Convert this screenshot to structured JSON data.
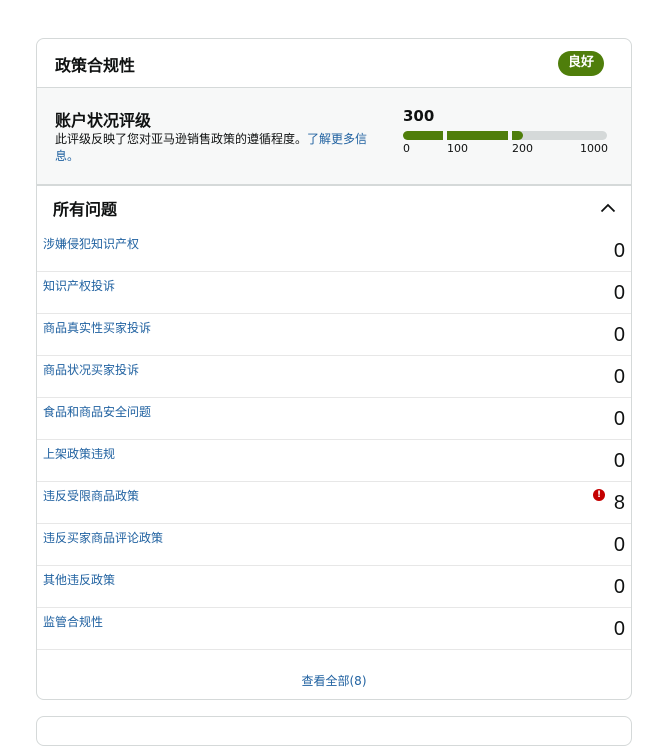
{
  "card": {
    "title": "政策合规性",
    "badge": "良好"
  },
  "ahr": {
    "title": "账户状况评级",
    "description": "此评级反映了您对亚马逊销售政策的遵循程度。",
    "learn_more": "了解更多信息。",
    "score": "300",
    "score_fraction": 0.3,
    "ticks": [
      "0",
      "100",
      "200",
      "1000"
    ],
    "bar_color": "#4f7e0b"
  },
  "issues": {
    "title": "所有问题",
    "toggle_icon": "chevron-up-icon",
    "rows": [
      {
        "label": "涉嫌侵犯知识产权",
        "count": "0"
      },
      {
        "label": "知识产权投诉",
        "count": "0"
      },
      {
        "label": "商品真实性买家投诉",
        "count": "0"
      },
      {
        "label": "商品状况买家投诉",
        "count": "0"
      },
      {
        "label": "食品和商品安全问题",
        "count": "0"
      },
      {
        "label": "上架政策违规",
        "count": "0"
      },
      {
        "label": "违反受限商品政策",
        "count": "8",
        "alert": true
      },
      {
        "label": "违反买家商品评论政策",
        "count": "0"
      },
      {
        "label": "其他违反政策",
        "count": "0"
      },
      {
        "label": "监管合规性",
        "count": "0"
      }
    ],
    "view_all": "查看全部(8)"
  },
  "colors": {
    "link": "#2162a1",
    "good": "#4f7e0b",
    "alert": "#c40000"
  }
}
